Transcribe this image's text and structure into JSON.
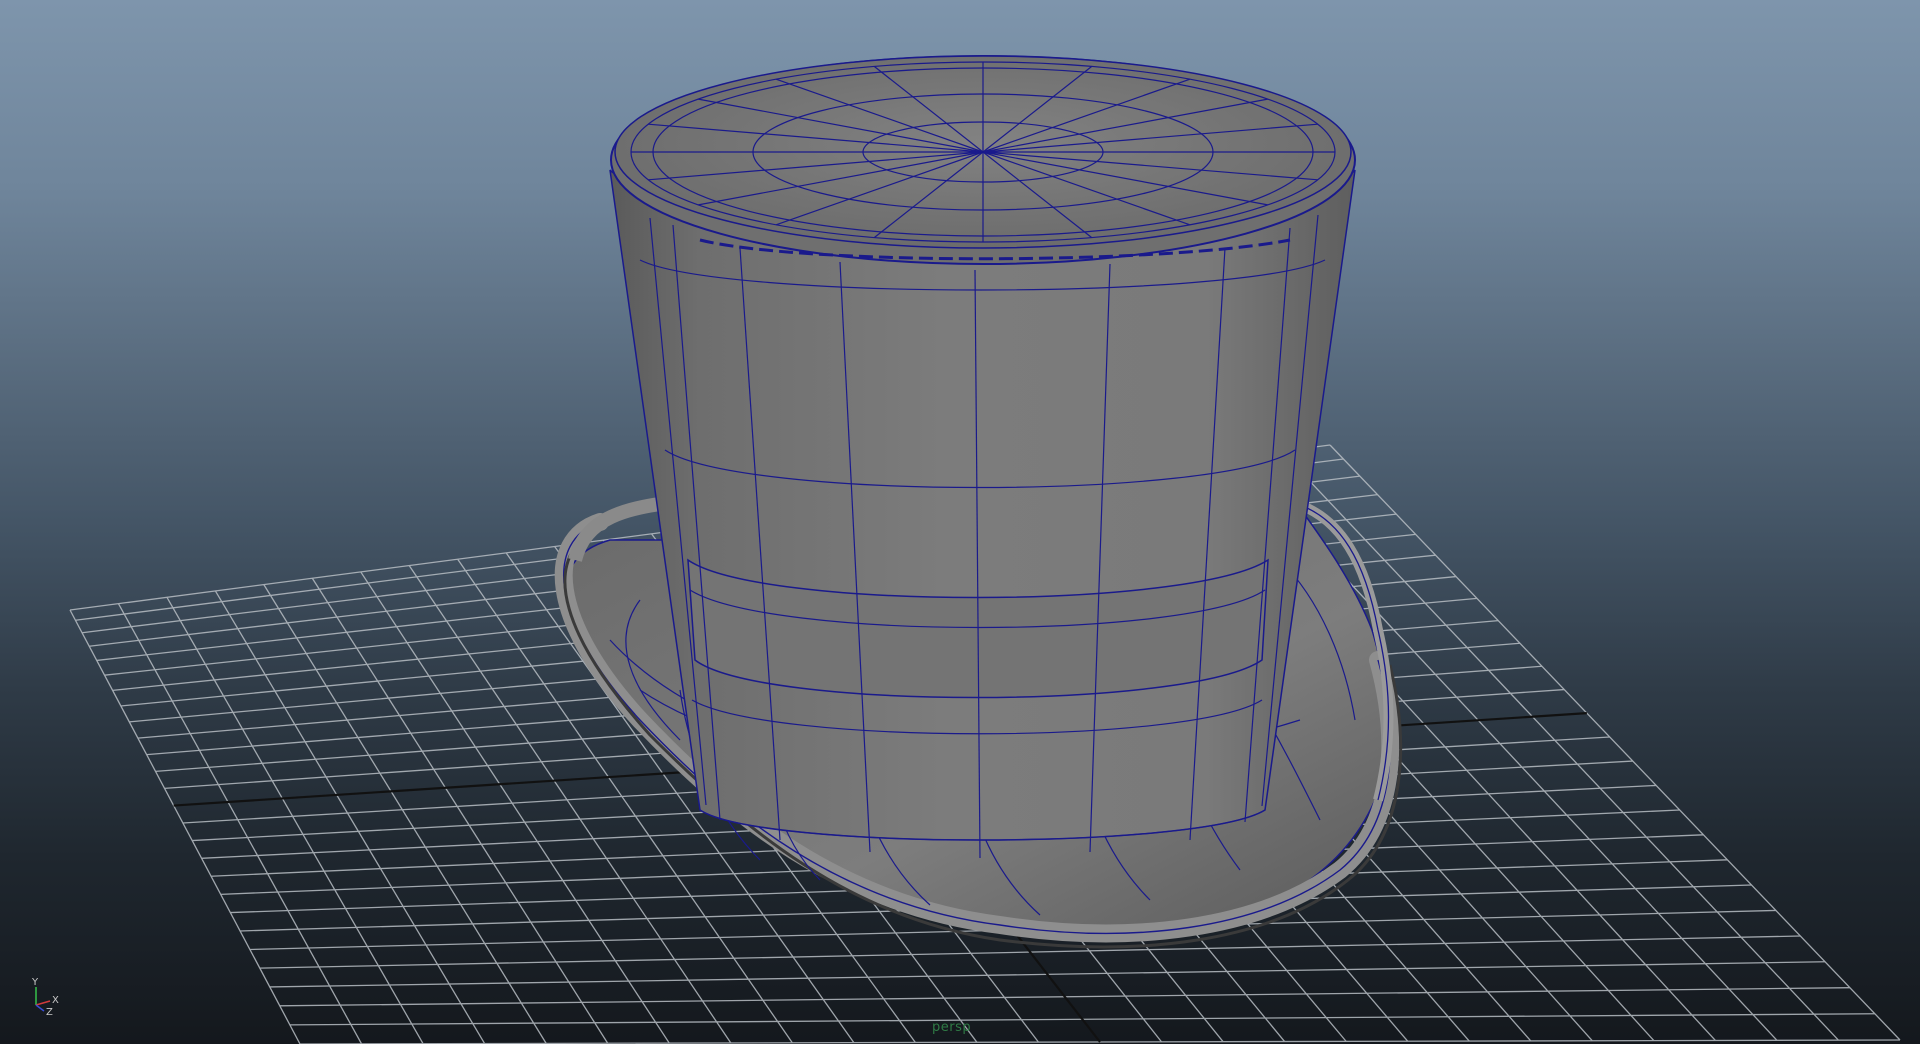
{
  "viewport": {
    "camera_name": "persp",
    "object": "top-hat",
    "display_mode": "smooth-shaded-wireframe-on-shaded",
    "colors": {
      "background_top": "#7e95ac",
      "background_bottom": "#14181d",
      "grid": "#b8bec4",
      "grid_axis": "#111111",
      "wireframe": "#1a1a8c",
      "mesh": "#7a7a7a"
    }
  },
  "axis_gizmo": {
    "y": "Y",
    "x": "X",
    "z": "Z"
  }
}
